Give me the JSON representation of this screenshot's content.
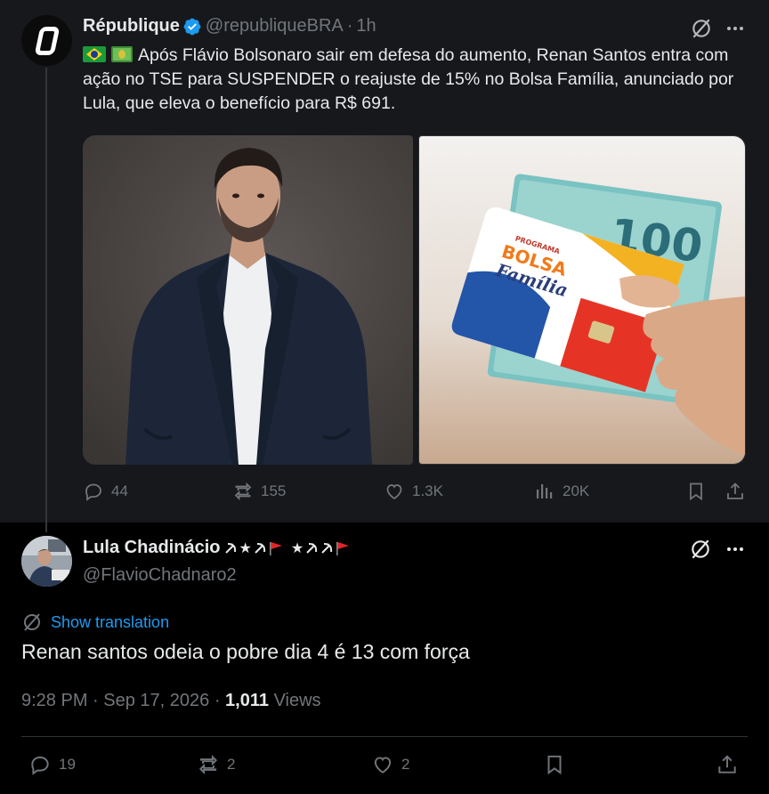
{
  "parent_tweet": {
    "author_name": "République",
    "handle": "@republiqueBRA",
    "separator": "·",
    "time": "1h",
    "text": "Após Flávio Bolsonaro sair em defesa do aumento, Renan Santos entra com ação no TSE para SUSPENDER o reajuste de 15% no Bolsa Família, anunciado por Lula, que eleva o benefício para R$ 691.",
    "emoji_icons": [
      "brazil-flag-icon",
      "money-icon"
    ],
    "images": [
      {
        "name": "man-in-suit-photo"
      },
      {
        "name": "bolsa-familia-card-photo",
        "card_text": [
          "PROGRAMA",
          "BOLSA",
          "Família"
        ],
        "banknote_value": "100"
      }
    ],
    "stats": {
      "replies": "44",
      "reposts": "155",
      "likes": "1.3K",
      "views": "20K"
    }
  },
  "main_tweet": {
    "author_name": "Lula Chadinácio",
    "name_emojis": [
      "hammer-sickle",
      "star",
      "hammer-sickle",
      "red-flag",
      "star",
      "hammer-sickle",
      "hammer-sickle",
      "red-flag"
    ],
    "handle": "@FlavioChadnaro2",
    "translate_label": "Show translation",
    "text": "Renan santos odeia o pobre dia 4 é 13 com força",
    "timestamp": "9:28 PM · Sep 17, 2026",
    "meta_separator": "·",
    "views_count": "1,011",
    "views_label": "Views",
    "stats": {
      "replies": "19",
      "reposts": "2",
      "likes": "2"
    }
  },
  "colors": {
    "background": "#000000",
    "parent_background": "#16181c",
    "text_primary": "#e7e9ea",
    "text_secondary": "#71767b",
    "accent": "#1d9bf0",
    "divider": "#2f3336"
  }
}
